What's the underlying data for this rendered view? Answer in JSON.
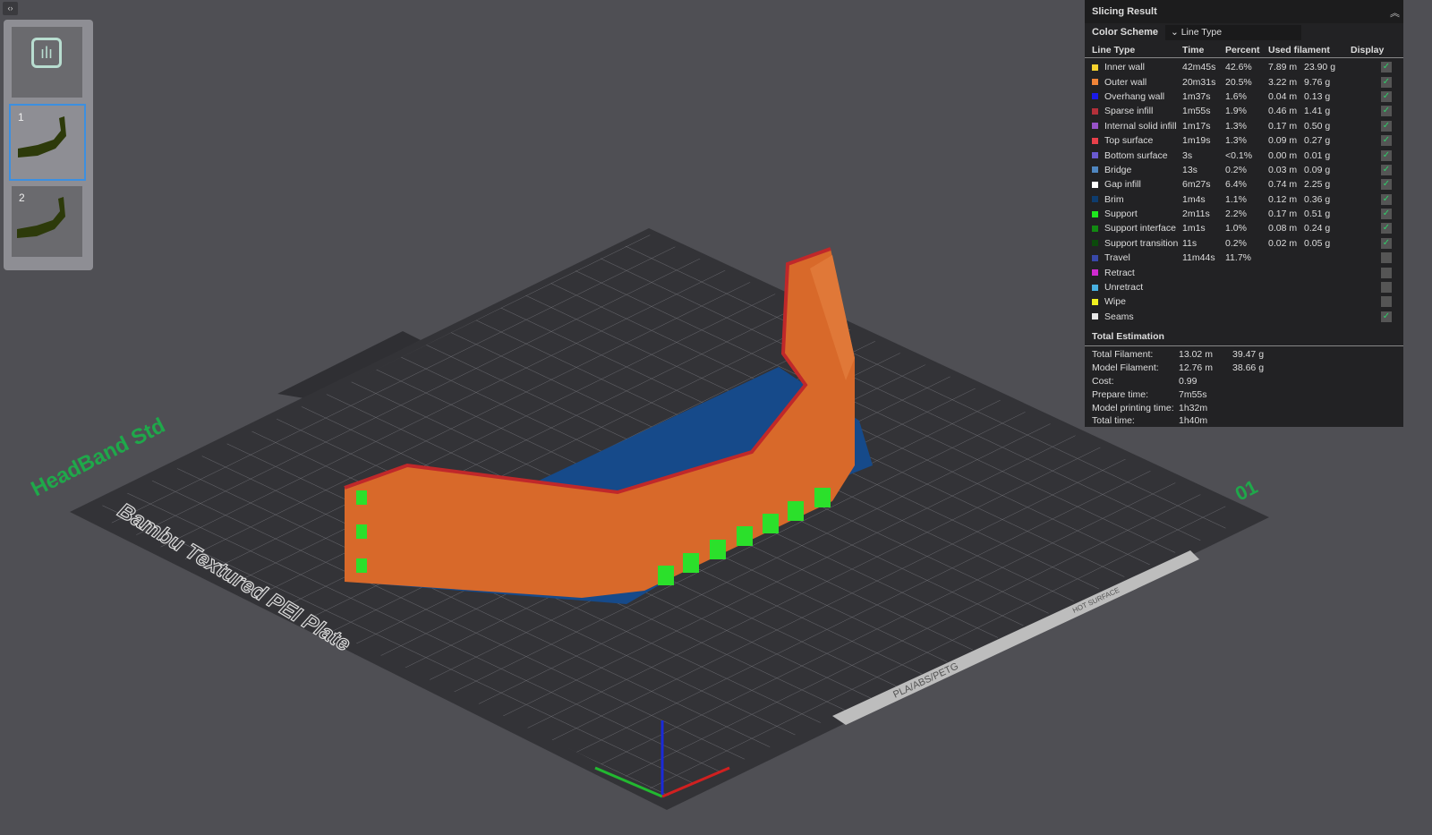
{
  "toolbar": {
    "collapse_icon": "code-collapse-icon"
  },
  "plates": [
    {
      "label": "1",
      "selected": true
    },
    {
      "label": "2",
      "selected": false
    }
  ],
  "plate": {
    "name": "Bambu Textured PEI Plate",
    "project": "HeadBand Std",
    "plate_number": "01",
    "marking1": "PLA/ABS/PETG",
    "marking2": "HOT SURFACE"
  },
  "panel": {
    "title": "Slicing Result",
    "color_scheme_label": "Color Scheme",
    "color_scheme_value": "Line Type",
    "headers": [
      "Line Type",
      "Time",
      "Percent",
      "Used filament",
      "Display"
    ],
    "rows": [
      {
        "name": "Inner wall",
        "color": "#f5d22e",
        "time": "42m45s",
        "percent": "42.6%",
        "length": "7.89 m",
        "weight": "23.90 g",
        "display": true
      },
      {
        "name": "Outer wall",
        "color": "#f08437",
        "time": "20m31s",
        "percent": "20.5%",
        "length": "3.22 m",
        "weight": "9.76 g",
        "display": true
      },
      {
        "name": "Overhang wall",
        "color": "#1a1ae8",
        "time": "1m37s",
        "percent": "1.6%",
        "length": "0.04 m",
        "weight": "0.13 g",
        "display": true
      },
      {
        "name": "Sparse infill",
        "color": "#b3303a",
        "time": "1m55s",
        "percent": "1.9%",
        "length": "0.46 m",
        "weight": "1.41 g",
        "display": true
      },
      {
        "name": "Internal solid infill",
        "color": "#9652c8",
        "time": "1m17s",
        "percent": "1.3%",
        "length": "0.17 m",
        "weight": "0.50 g",
        "display": true
      },
      {
        "name": "Top surface",
        "color": "#e8404a",
        "time": "1m19s",
        "percent": "1.3%",
        "length": "0.09 m",
        "weight": "0.27 g",
        "display": true
      },
      {
        "name": "Bottom surface",
        "color": "#6a5ad0",
        "time": "3s",
        "percent": "<0.1%",
        "length": "0.00 m",
        "weight": "0.01 g",
        "display": true
      },
      {
        "name": "Bridge",
        "color": "#4f86c0",
        "time": "13s",
        "percent": "0.2%",
        "length": "0.03 m",
        "weight": "0.09 g",
        "display": true
      },
      {
        "name": "Gap infill",
        "color": "#ffffff",
        "time": "6m27s",
        "percent": "6.4%",
        "length": "0.74 m",
        "weight": "2.25 g",
        "display": true
      },
      {
        "name": "Brim",
        "color": "#0e3c6e",
        "time": "1m4s",
        "percent": "1.1%",
        "length": "0.12 m",
        "weight": "0.36 g",
        "display": true
      },
      {
        "name": "Support",
        "color": "#1ee81e",
        "time": "2m11s",
        "percent": "2.2%",
        "length": "0.17 m",
        "weight": "0.51 g",
        "display": true
      },
      {
        "name": "Support interface",
        "color": "#128a12",
        "time": "1m1s",
        "percent": "1.0%",
        "length": "0.08 m",
        "weight": "0.24 g",
        "display": true
      },
      {
        "name": "Support transition",
        "color": "#0b4a0b",
        "time": "11s",
        "percent": "0.2%",
        "length": "0.02 m",
        "weight": "0.05 g",
        "display": true
      },
      {
        "name": "Travel",
        "color": "#3848a8",
        "time": "11m44s",
        "percent": "11.7%",
        "length": "",
        "weight": "",
        "display": false
      },
      {
        "name": "Retract",
        "color": "#d02ad0",
        "time": "",
        "percent": "",
        "length": "",
        "weight": "",
        "display": false
      },
      {
        "name": "Unretract",
        "color": "#48b0e0",
        "time": "",
        "percent": "",
        "length": "",
        "weight": "",
        "display": false
      },
      {
        "name": "Wipe",
        "color": "#f0f020",
        "time": "",
        "percent": "",
        "length": "",
        "weight": "",
        "display": false
      },
      {
        "name": "Seams",
        "color": "#e8e8e8",
        "time": "",
        "percent": "",
        "length": "",
        "weight": "",
        "display": true
      }
    ],
    "total_title": "Total Estimation",
    "totals": [
      {
        "label": "Total Filament:",
        "v1": "13.02 m",
        "v2": "39.47 g"
      },
      {
        "label": "Model Filament:",
        "v1": "12.76 m",
        "v2": "38.66 g"
      },
      {
        "label": "Cost:",
        "v1": "0.99",
        "v2": ""
      },
      {
        "label": "Prepare time:",
        "v1": "7m55s",
        "v2": ""
      },
      {
        "label": "Model printing time:",
        "v1": "1h32m",
        "v2": ""
      },
      {
        "label": "Total time:",
        "v1": "1h40m",
        "v2": ""
      }
    ]
  }
}
